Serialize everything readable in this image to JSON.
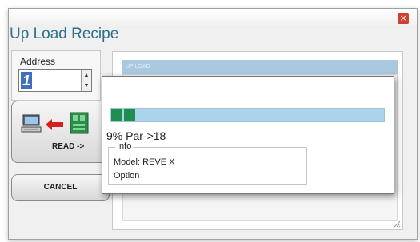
{
  "window": {
    "close_glyph": "×"
  },
  "heading": "Up Load Recipe",
  "address": {
    "label": "Address",
    "value": "1",
    "spin_up": "▲",
    "spin_down": "▼"
  },
  "read_button": {
    "label": "READ ->",
    "icons": [
      "computer-icon",
      "left-arrow-icon",
      "device-module-icon"
    ]
  },
  "cancel_button": {
    "label": "CANCEL"
  },
  "panel": {
    "header": "UP LOAD"
  },
  "progress": {
    "percent": 9,
    "text": "9% Par->18"
  },
  "info": {
    "legend": "Info",
    "model": "Model: REVE X",
    "option": "Option"
  },
  "colors": {
    "heading": "#2e6f8c",
    "progress_fill": "#1f8f4f",
    "progress_track": "#a9d4ec",
    "close_button": "#d04030"
  }
}
